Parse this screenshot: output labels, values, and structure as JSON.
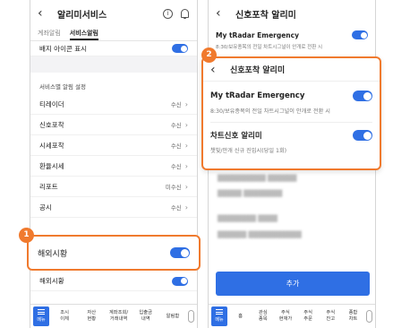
{
  "left": {
    "title": "알리미서비스",
    "info_icon": "info-icon",
    "bell_icon": "bell-icon",
    "tabs": [
      "계좌알림",
      "서비스알림"
    ],
    "badge_row": {
      "label": "배지 아이콘 표시"
    },
    "section_title": "서비스별 알림 설정",
    "items": [
      {
        "label": "티레이더",
        "value": "수신"
      },
      {
        "label": "신호포착",
        "value": "수신"
      },
      {
        "label": "시세포착",
        "value": "수신"
      },
      {
        "label": "환율시세",
        "value": "수신"
      },
      {
        "label": "리포트",
        "value": "미수신"
      },
      {
        "label": "공시",
        "value": "수신"
      }
    ],
    "highlight_label": "해외시황",
    "highlight_badge": "1",
    "after_row": {
      "label": "해외시황"
    },
    "nav": {
      "menu": "메뉴",
      "items": [
        "조시\n이체",
        "자산\n현황",
        "계좌조회/\n거래내역",
        "입출금\n내역",
        "알림함"
      ]
    }
  },
  "right": {
    "title": "신호포착 알리미",
    "top_row": {
      "label": "My tRadar Emergency",
      "desc": "8:30/보유종목의 전일 차트시그널이 안개로 전환 시"
    },
    "popup": {
      "badge": "2",
      "title": "신호포착 알리미",
      "row1": {
        "label": "My tRadar Emergency",
        "desc": "8:30/보유종목의 전일 차트시그널이 안개로 전환 시"
      },
      "row2": {
        "label": "차트신호 알리미",
        "desc": "챗빛/안개 신규 진입시(당일 1회)"
      }
    },
    "add_button": "추가",
    "nav": {
      "menu": "메뉴",
      "items": [
        "홈",
        "관심\n종목",
        "주식\n현재가",
        "주식\n주문",
        "주식\n잔고",
        "종합\n차트"
      ]
    }
  },
  "colors": {
    "accent": "#2f6fe4",
    "callout": "#f07a2e"
  }
}
